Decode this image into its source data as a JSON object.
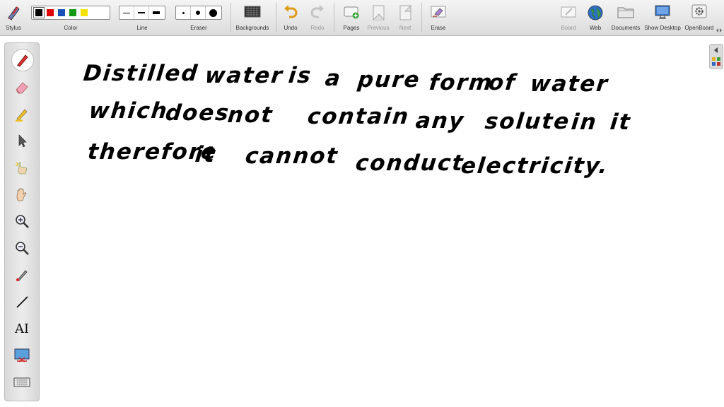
{
  "toolbar": {
    "stylus": "Stylus",
    "color": "Color",
    "line": "Line",
    "eraser": "Eraser",
    "backgrounds": "Backgrounds",
    "undo": "Undo",
    "redo": "Redo",
    "pages": "Pages",
    "previous": "Previous",
    "next": "Next",
    "erase": "Erase",
    "board": "Board",
    "web": "Web",
    "documents": "Documents",
    "show_desktop": "Show Desktop",
    "openboard": "OpenBoard",
    "colors": [
      "#000000",
      "#e00000",
      "#1850b8",
      "#149a14",
      "#f4e200"
    ]
  },
  "sidebar": {
    "text_tool": "AI"
  },
  "board": {
    "lines": [
      [
        "Distilled",
        "water",
        "is",
        "a",
        "pure",
        "form",
        "of",
        "water"
      ],
      [
        "which",
        "does",
        "not",
        "contain",
        "any",
        "solute",
        "in",
        "it"
      ],
      [
        "therefore",
        "it",
        "cannot",
        "conduct",
        "electricity."
      ]
    ]
  }
}
